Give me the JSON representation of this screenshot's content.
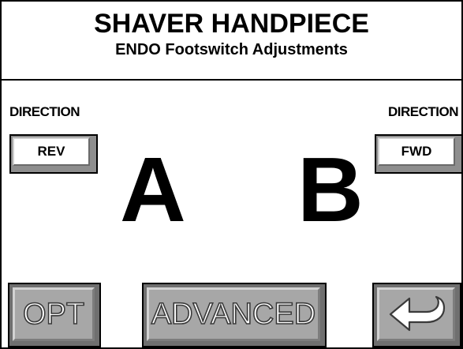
{
  "header": {
    "title": "SHAVER HANDPIECE",
    "subtitle": "ENDO Footswitch Adjustments"
  },
  "left": {
    "direction_label": "DIRECTION",
    "button_label": "REV",
    "letter": "A"
  },
  "right": {
    "direction_label": "DIRECTION",
    "button_label": "FWD",
    "letter": "B"
  },
  "bottom": {
    "opt_label": "OPT",
    "advanced_label": "ADVANCED",
    "back_icon": "return-arrow-icon"
  },
  "colors": {
    "button_gray": "#a7a7a7",
    "button_shadow": "#6f6f6f",
    "text": "#000000"
  }
}
